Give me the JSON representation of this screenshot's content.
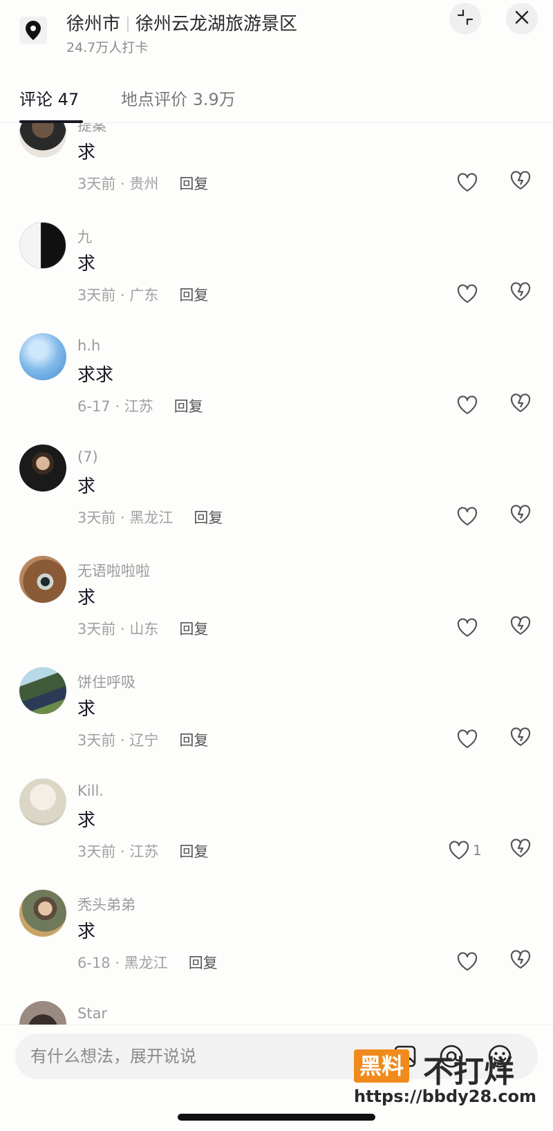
{
  "header": {
    "city": "徐州市",
    "place": "徐州云龙湖旅游景区",
    "checkins": "24.7万人打卡"
  },
  "tabs": [
    {
      "label": "评论 47",
      "active": true
    },
    {
      "label": "地点评价 3.9万",
      "active": false
    }
  ],
  "reply_label": "回复",
  "comments": [
    {
      "username": "提案",
      "text": "求",
      "time": "3天前 · 贵州",
      "likes": ""
    },
    {
      "username": "九",
      "text": "求",
      "time": "3天前 · 广东",
      "likes": ""
    },
    {
      "username": "h.h",
      "text": "求求",
      "time": "6-17 · 江苏",
      "likes": ""
    },
    {
      "username": "(7)",
      "text": "求",
      "time": "3天前 · 黑龙江",
      "likes": ""
    },
    {
      "username": "无语啦啦啦",
      "text": "求",
      "time": "3天前 · 山东",
      "likes": ""
    },
    {
      "username": "饼住呼吸",
      "text": "求",
      "time": "3天前 · 辽宁",
      "likes": ""
    },
    {
      "username": "Kill.",
      "text": "求",
      "time": "3天前 · 江苏",
      "likes": "1"
    },
    {
      "username": "秃头弟弟",
      "text": "求",
      "time": "6-18 · 黑龙江",
      "likes": ""
    },
    {
      "username": "Star",
      "text": "",
      "time": "",
      "likes": ""
    }
  ],
  "input": {
    "placeholder": "有什么想法，展开说说"
  },
  "watermark": {
    "badge": "黑料",
    "big": "不打烊",
    "url": "https://bbdy28.com"
  },
  "colors": {
    "text": "#161823",
    "muted": "#a0a0a0",
    "watermark_orange": "#f08a1c"
  }
}
